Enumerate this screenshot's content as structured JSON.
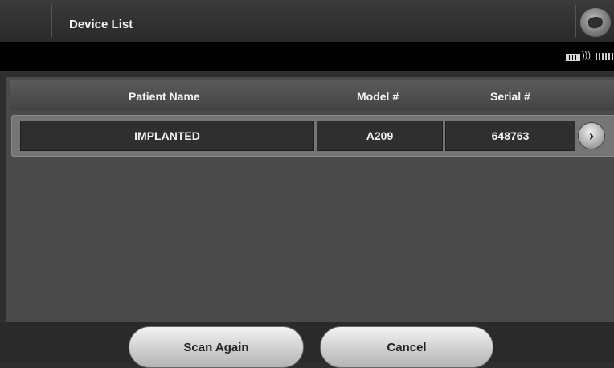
{
  "header": {
    "title": "Device List",
    "logo_icon": "device-logo-icon"
  },
  "status": {
    "battery_icon": "battery-icon",
    "wifi_icon": "wifi-icon",
    "signal_icon": "signal-icon"
  },
  "table": {
    "columns": [
      "Patient Name",
      "Model #",
      "Serial #"
    ],
    "rows": [
      {
        "patient_name": "IMPLANTED",
        "model": "A209",
        "serial": "648763"
      }
    ]
  },
  "actions": {
    "scan_again": "Scan Again",
    "cancel": "Cancel"
  },
  "colors": {
    "background": "#2e2e2e",
    "panel": "#4a4a4a",
    "row": "#757575",
    "button": "#d8d8d8"
  }
}
